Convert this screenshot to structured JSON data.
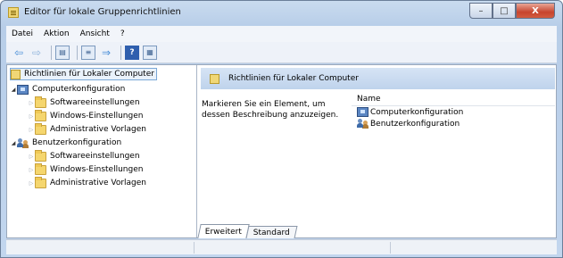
{
  "window": {
    "title": "Editor für lokale Gruppenrichtlinien",
    "buttons": {
      "minimize": "–",
      "maximize": "□",
      "close": "X"
    }
  },
  "menu": [
    "Datei",
    "Aktion",
    "Ansicht",
    "?"
  ],
  "toolbar": {
    "icons": [
      "back-arrow-icon",
      "forward-arrow-icon",
      "show-tree-icon",
      "properties-icon",
      "export-list-icon",
      "help-icon",
      "view-icon"
    ],
    "help_glyph": "?"
  },
  "tree": {
    "root": "Richtlinien für Lokaler Computer",
    "computer": {
      "label": "Computerkonfiguration",
      "children": [
        "Softwareeinstellungen",
        "Windows-Einstellungen",
        "Administrative Vorlagen"
      ]
    },
    "user": {
      "label": "Benutzerkonfiguration",
      "children": [
        "Softwareeinstellungen",
        "Windows-Einstellungen",
        "Administrative Vorlagen"
      ]
    }
  },
  "details": {
    "header": "Richtlinien für Lokaler Computer",
    "description": "Markieren Sie ein Element, um dessen Beschreibung anzuzeigen.",
    "column_name": "Name",
    "items": [
      "Computerkonfiguration",
      "Benutzerkonfiguration"
    ]
  },
  "tabs": {
    "extended": "Erweitert",
    "standard": "Standard"
  }
}
